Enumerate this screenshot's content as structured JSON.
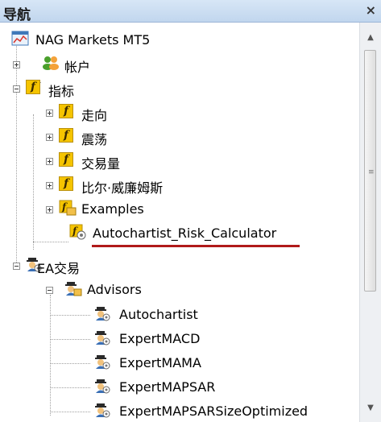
{
  "panel": {
    "title": "导航",
    "close_glyph": "×"
  },
  "tree": {
    "root": {
      "label": "NAG Markets MT5",
      "icon": "terminal-icon"
    },
    "account": {
      "label": "帐户",
      "icon": "accounts-icon"
    },
    "indicators": {
      "label": "指标",
      "icon": "indicator-folder-icon",
      "children": [
        {
          "label": "走向",
          "icon": "indicator-folder-icon"
        },
        {
          "label": "震荡",
          "icon": "indicator-folder-icon"
        },
        {
          "label": "交易量",
          "icon": "indicator-folder-icon"
        },
        {
          "label": "比尔·威廉姆斯",
          "icon": "indicator-folder-icon"
        },
        {
          "label": "Examples",
          "icon": "examples-folder-icon"
        },
        {
          "label": "Autochartist_Risk_Calculator",
          "icon": "indicator-script-icon",
          "underline_color": "#b01a1a"
        }
      ]
    },
    "ea": {
      "label": "EA交易",
      "icon": "expert-advisor-icon",
      "advisors": {
        "label": "Advisors",
        "icon": "expert-advisor-folder-icon",
        "children": [
          {
            "label": "Autochartist",
            "icon": "expert-advisor-icon"
          },
          {
            "label": "ExpertMACD",
            "icon": "expert-advisor-icon"
          },
          {
            "label": "ExpertMAMA",
            "icon": "expert-advisor-icon"
          },
          {
            "label": "ExpertMAPSAR",
            "icon": "expert-advisor-icon"
          },
          {
            "label": "ExpertMAPSARSizeOptimized",
            "icon": "expert-advisor-icon"
          }
        ]
      }
    }
  },
  "scrollbar": {
    "up_glyph": "▲",
    "down_glyph": "▼",
    "grip_glyph": "≡"
  },
  "colors": {
    "title_bg": "#c9dcf1",
    "indicator_yellow": "#f5c400",
    "highlight_underline": "#b01a1a"
  }
}
